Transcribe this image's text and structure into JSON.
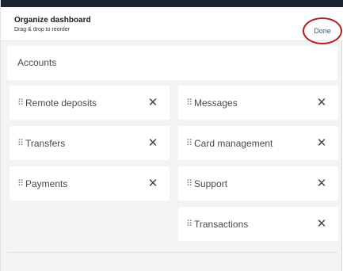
{
  "header": {
    "title": "Organize dashboard",
    "subtitle": "Drag & drop to reorder",
    "done_label": "Done"
  },
  "accounts": {
    "label": "Accounts"
  },
  "grip_glyph": "⠿",
  "close_glyph": "✕",
  "cards": [
    {
      "label": "Remote deposits"
    },
    {
      "label": "Messages"
    },
    {
      "label": "Transfers"
    },
    {
      "label": "Card management"
    },
    {
      "label": "Payments"
    },
    {
      "label": "Support"
    },
    {
      "label": "Transactions"
    }
  ],
  "colors": {
    "accent_link": "#1f5fa8",
    "highlight_circle": "#b01f24",
    "background": "#f3f3f3"
  }
}
